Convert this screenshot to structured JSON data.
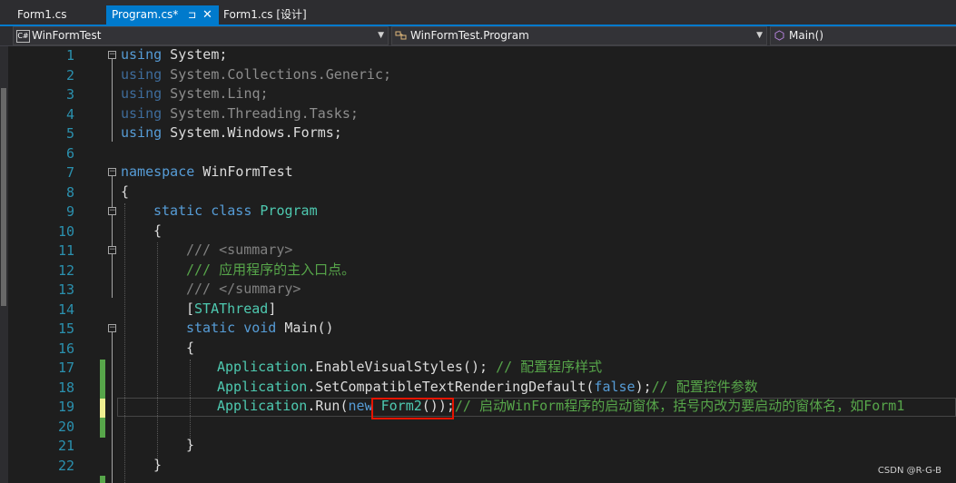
{
  "tabs": [
    {
      "label": "Form1.cs",
      "active": false
    },
    {
      "label": "Program.cs*",
      "active": true,
      "pin": "⊐",
      "close": "✕"
    },
    {
      "label": "Form1.cs [设计]",
      "active": false
    }
  ],
  "navbar": {
    "project": "WinFormTest",
    "project_icon": "C#",
    "class": "WinFormTest.Program",
    "member": "Main()"
  },
  "line_numbers": [
    "1",
    "2",
    "3",
    "4",
    "5",
    "6",
    "7",
    "8",
    "9",
    "10",
    "11",
    "12",
    "13",
    "14",
    "15",
    "16",
    "17",
    "18",
    "19",
    "20",
    "21",
    "22"
  ],
  "code": {
    "l1_kw": "using",
    "l1_rest": " System;",
    "l2_kw": "using",
    "l2_rest": " System.Collections.Generic;",
    "l3_kw": "using",
    "l3_rest": " System.Linq;",
    "l4_kw": "using",
    "l4_rest": " System.Threading.Tasks;",
    "l5_kw": "using",
    "l5_rest": " System.Windows.Forms;",
    "l7_kw": "namespace",
    "l7_rest": " WinFormTest",
    "l8": "{",
    "l9_kw": "static class",
    "l9_cls": "Program",
    "l10": "{",
    "l11_slash": "/// ",
    "l11_tag": "<summary>",
    "l12": "/// 应用程序的主入口点。",
    "l13_slash": "/// ",
    "l13_tag": "</summary>",
    "l14_open": "[",
    "l14_cls": "STAThread",
    "l14_close": "]",
    "l15_kw": "static void",
    "l15_rest": " Main()",
    "l16": "{",
    "l17_cls": "Application",
    "l17_rest": ".EnableVisualStyles(); ",
    "l17_cm": "// 配置程序样式",
    "l18_cls": "Application",
    "l18_rest": ".SetCompatibleTextRenderingDefault(",
    "l18_kw": "false",
    "l18_rest2": ");",
    "l18_cm": "// 配置控件参数",
    "l19_cls": "Application",
    "l19_rest": ".Run(",
    "l19_kw": "new",
    "l19_cls2": "Form2",
    "l19_rest2": "());",
    "l19_cm": "// 启动WinForm程序的启动窗体，括号内改为要启动的窗体名，如Form1",
    "l21": "}",
    "l22": "}"
  },
  "colors": {
    "keyword": "#569cd6",
    "type": "#4ec9b0",
    "comment": "#57a64a",
    "accent": "#007acc",
    "highlight": "#e51400"
  },
  "watermark": "CSDN @R-G-B"
}
